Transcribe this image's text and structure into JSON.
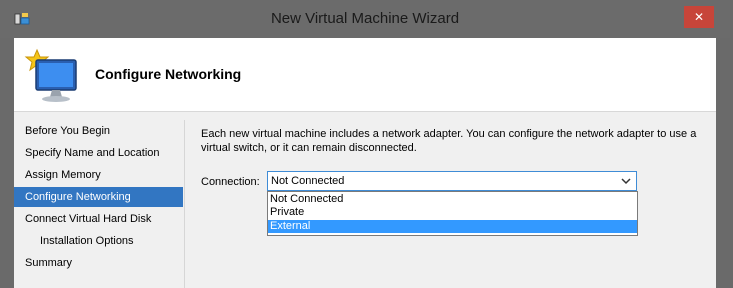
{
  "window": {
    "title": "New Virtual Machine Wizard",
    "close_symbol": "✕",
    "accent_color": "#3276c2",
    "close_color": "#c7453a"
  },
  "header": {
    "title": "Configure Networking",
    "icon": "new-vm-monitor-icon"
  },
  "nav": {
    "items": [
      {
        "label": "Before You Begin",
        "selected": false
      },
      {
        "label": "Specify Name and Location",
        "selected": false
      },
      {
        "label": "Assign Memory",
        "selected": false
      },
      {
        "label": "Configure Networking",
        "selected": true
      },
      {
        "label": "Connect Virtual Hard Disk",
        "selected": false
      },
      {
        "label": "Installation Options",
        "selected": false,
        "sub": true
      },
      {
        "label": "Summary",
        "selected": false
      }
    ]
  },
  "content": {
    "description": "Each new virtual machine includes a network adapter. You can configure the network adapter to use a virtual switch, or it can remain disconnected.",
    "connection_label": "Connection:",
    "connection_value": "Not Connected",
    "options": [
      "Not Connected",
      "Private",
      "External"
    ],
    "highlighted_option": "External"
  }
}
